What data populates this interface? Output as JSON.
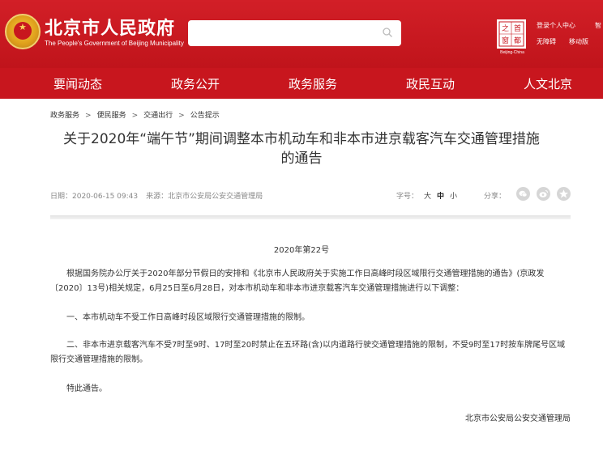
{
  "header": {
    "site_title": "北京市人民政府",
    "site_subtitle": "The People's Government of Beijing Municipality",
    "search_placeholder": "",
    "logo2_chars": [
      "之",
      "首",
      "窗",
      "都"
    ],
    "logo2_caption": "Beijing-China",
    "top_links": [
      "登录个人中心",
      "智",
      "无障碍",
      "移动版"
    ],
    "brand_color": "#c8161e"
  },
  "nav": {
    "items": [
      "要闻动态",
      "政务公开",
      "政务服务",
      "政民互动",
      "人文北京"
    ]
  },
  "breadcrumb": [
    "政务服务",
    "便民服务",
    "交通出行",
    "公告提示"
  ],
  "breadcrumb_sep": ">",
  "article": {
    "title_line1": "关于2020年“端午节”期间调整本市机动车和非本市进京载客汽车交通管理措施",
    "title_line2": "的通告",
    "date": "日期：2020-06-15 09:43",
    "source": "来源：北京市公安局公安交通管理局",
    "font_size_label": "字号：",
    "font_size_options": [
      "大",
      "中",
      "小"
    ],
    "font_size_active": "中",
    "share_label": "分享：",
    "share_icons": [
      "wechat-icon",
      "weibo-icon",
      "favorite-icon"
    ],
    "doc_number": "2020年第22号",
    "paragraphs": [
      "根据国务院办公厅关于2020年部分节假日的安排和《北京市人民政府关于实施工作日高峰时段区域限行交通管理措施的通告》(京政发〔2020〕13号)相关规定，6月25日至6月28日，对本市机动车和非本市进京载客汽车交通管理措施进行以下调整：",
      "一、本市机动车不受工作日高峰时段区域限行交通管理措施的限制。",
      "二、非本市进京载客汽车不受7时至9时、17时至20时禁止在五环路(含)以内道路行驶交通管理措施的限制，不受9时至17时按车牌尾号区域限行交通管理措施的限制。",
      "特此通告。"
    ],
    "signature": "北京市公安局公安交通管理局"
  }
}
